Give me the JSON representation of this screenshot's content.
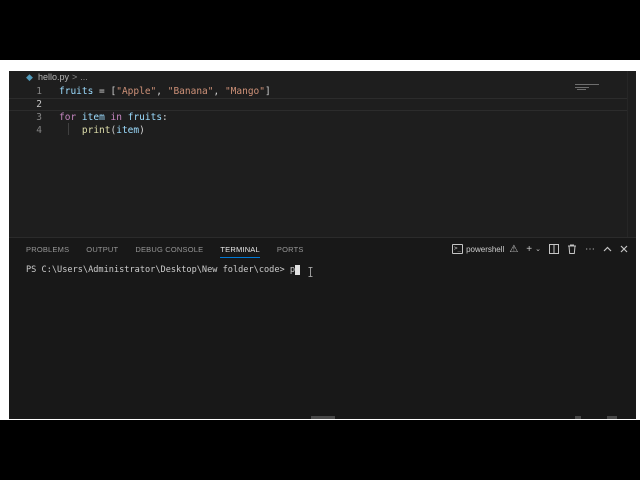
{
  "editor": {
    "breadcrumb": {
      "file": "hello.py",
      "separator": ">",
      "more": "..."
    },
    "lines": [
      {
        "num": "1",
        "tokens": [
          {
            "t": "fruits",
            "c": "var"
          },
          {
            "t": " = [",
            "c": "punc"
          },
          {
            "t": "\"Apple\"",
            "c": "str"
          },
          {
            "t": ", ",
            "c": "punc"
          },
          {
            "t": "\"Banana\"",
            "c": "str"
          },
          {
            "t": ", ",
            "c": "punc"
          },
          {
            "t": "\"Mango\"",
            "c": "str"
          },
          {
            "t": "]",
            "c": "punc"
          }
        ]
      },
      {
        "num": "2",
        "tokens": [],
        "current": true
      },
      {
        "num": "3",
        "tokens": [
          {
            "t": "for",
            "c": "kw"
          },
          {
            "t": " ",
            "c": "punc"
          },
          {
            "t": "item",
            "c": "var"
          },
          {
            "t": " ",
            "c": "punc"
          },
          {
            "t": "in",
            "c": "kw"
          },
          {
            "t": " ",
            "c": "punc"
          },
          {
            "t": "fruits",
            "c": "var"
          },
          {
            "t": ":",
            "c": "punc"
          }
        ]
      },
      {
        "num": "4",
        "tokens": [
          {
            "t": "    ",
            "c": "punc"
          },
          {
            "t": "print",
            "c": "fn"
          },
          {
            "t": "(",
            "c": "punc"
          },
          {
            "t": "item",
            "c": "var"
          },
          {
            "t": ")",
            "c": "punc"
          }
        ]
      }
    ]
  },
  "panel": {
    "tabs": [
      {
        "label": "PROBLEMS",
        "active": false
      },
      {
        "label": "OUTPUT",
        "active": false
      },
      {
        "label": "DEBUG CONSOLE",
        "active": false
      },
      {
        "label": "TERMINAL",
        "active": true
      },
      {
        "label": "PORTS",
        "active": false
      }
    ],
    "shell_label": "powershell",
    "actions": [
      "new-terminal",
      "split-dropdown",
      "split-terminal",
      "kill-terminal",
      "more",
      "maximize",
      "close"
    ]
  },
  "terminal": {
    "prompt": "PS C:\\Users\\Administrator\\Desktop\\New folder\\code> ",
    "typed": "p"
  },
  "colors": {
    "editor_bg": "#1e1e1e",
    "panel_bg": "#181818",
    "accent": "#0078d4",
    "keyword": "#c586c0",
    "string": "#ce9178",
    "variable": "#9cdcfe",
    "function": "#dcdcaa"
  }
}
